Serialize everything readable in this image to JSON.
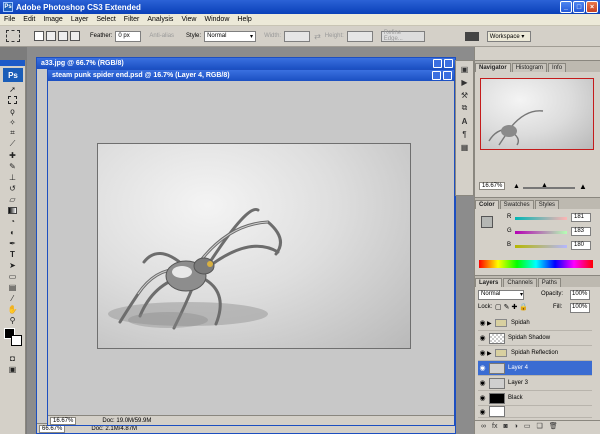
{
  "app": {
    "title": "Adobe Photoshop CS3 Extended",
    "logo": "Ps"
  },
  "window_controls": {
    "minimize": "_",
    "maximize": "□",
    "close": "×"
  },
  "menu": [
    "File",
    "Edit",
    "Image",
    "Layer",
    "Select",
    "Filter",
    "Analysis",
    "View",
    "Window",
    "Help"
  ],
  "options": {
    "feather_label": "Feather:",
    "feather_value": "0 px",
    "antialias": "Anti-alias",
    "style_label": "Style:",
    "style_value": "Normal",
    "width_label": "Width:",
    "height_label": "Height:",
    "refine": "Refine Edge...",
    "workspace": "Workspace ▾"
  },
  "docs": {
    "back": {
      "title": "a33.jpg @ 66.7% (RGB/8)",
      "zoom": "66.67%",
      "info": "Doc: 2.1M/4.87M"
    },
    "front": {
      "title": "steam punk spider end.psd @ 16.7% (Layer 4, RGB/8)",
      "zoom": "16.67%",
      "info": "Doc: 19.0M/59.9M"
    }
  },
  "navigator": {
    "tabs": [
      "Navigator",
      "Histogram",
      "Info"
    ],
    "zoom": "16.67%"
  },
  "color": {
    "tabs": [
      "Color",
      "Swatches",
      "Styles"
    ],
    "r": "181",
    "g": "183",
    "b": "180"
  },
  "layers": {
    "tabs": [
      "Layers",
      "Channels",
      "Paths"
    ],
    "blend": "Normal",
    "opacity_label": "Opacity:",
    "opacity": "100%",
    "lock_label": "Lock:",
    "fill_label": "Fill:",
    "fill": "100%",
    "items": [
      {
        "name": "Spidah",
        "type": "folder"
      },
      {
        "name": "Spidah Shadow",
        "type": "layer"
      },
      {
        "name": "Spidah Reflection",
        "type": "folder"
      },
      {
        "name": "Layer 4",
        "type": "layer",
        "selected": true
      },
      {
        "name": "Layer 3",
        "type": "layer"
      },
      {
        "name": "Black",
        "type": "layer"
      }
    ]
  },
  "colors": {
    "accent": "#1b4fc2",
    "selection": "#3a6cd2"
  }
}
